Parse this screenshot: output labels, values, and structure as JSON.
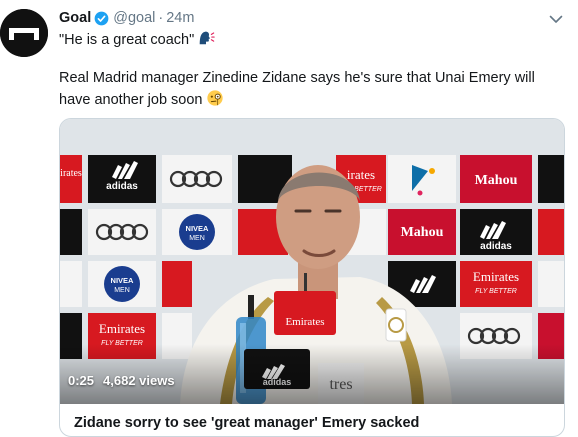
{
  "tweet": {
    "author_name": "Goal",
    "handle": "@goal",
    "separator": "·",
    "time": "24m",
    "quote": "\"He is a great coach\"",
    "body": "Real Madrid manager Zinedine Zidane says he's sure that Unai Emery will have another job soon"
  },
  "media": {
    "duration": "0:25",
    "views": "4,682 views",
    "sponsor_texts": {
      "adidas": "adidas",
      "mahou": "Mahou",
      "emirates": "Emirates",
      "fly_better": "FLY BETTER",
      "nivea": "NIVEA",
      "men": "MEN",
      "emirates_cut": "irates",
      "tres": "tres"
    }
  },
  "card": {
    "title": "Zidane sorry to see 'great manager' Emery sacked"
  },
  "icons": {
    "avatar": "goal-logo-icon",
    "verified": "verified-badge-icon",
    "menu": "chevron-down-icon",
    "speaking_emoji": "speaking-head-emoji",
    "monocle_emoji": "face-with-monocle-emoji"
  },
  "colors": {
    "verified_blue": "#1da1f2",
    "secondary_text": "#657786",
    "card_border": "#ccd6dd",
    "emirates_red": "#d71920",
    "mahou_red": "#c8102e",
    "caixa_blue": "#0d6ea8"
  }
}
